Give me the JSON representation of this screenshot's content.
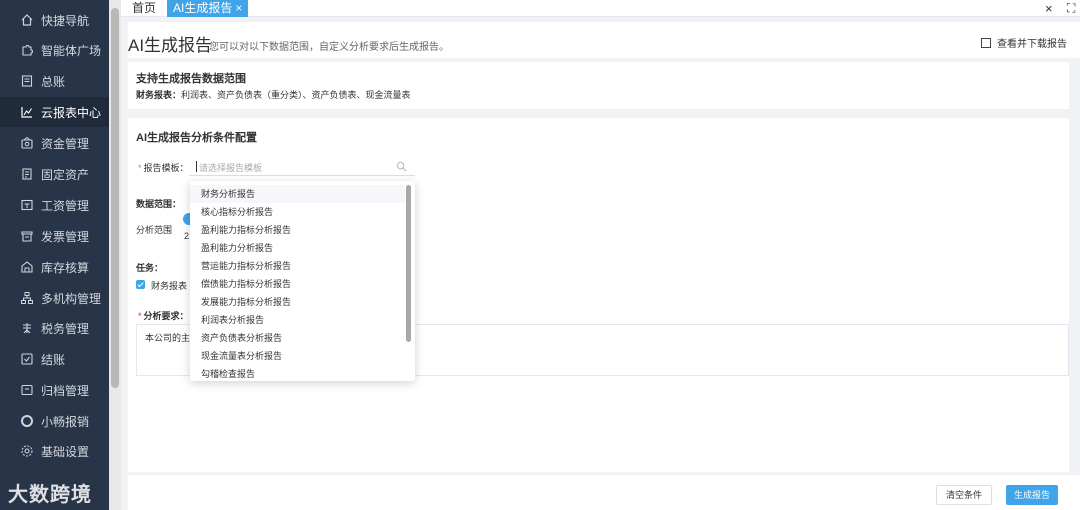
{
  "sidebar": {
    "items": [
      {
        "label": "快捷导航",
        "icon": "home-icon"
      },
      {
        "label": "智能体广场",
        "icon": "puzzle-icon"
      },
      {
        "label": "总账",
        "icon": "ledger-icon"
      },
      {
        "label": "云报表中心",
        "icon": "chart-icon",
        "active": true
      },
      {
        "label": "资金管理",
        "icon": "money-icon"
      },
      {
        "label": "固定资产",
        "icon": "asset-icon"
      },
      {
        "label": "工资管理",
        "icon": "salary-icon"
      },
      {
        "label": "发票管理",
        "icon": "invoice-icon"
      },
      {
        "label": "库存核算",
        "icon": "warehouse-icon"
      },
      {
        "label": "多机构管理",
        "icon": "org-icon"
      },
      {
        "label": "税务管理",
        "icon": "tax-icon"
      },
      {
        "label": "结账",
        "icon": "checkout-icon"
      },
      {
        "label": "归档管理",
        "icon": "archive-icon"
      },
      {
        "label": "小畅报销",
        "icon": "reimburse-icon"
      },
      {
        "label": "基础设置",
        "icon": "settings-icon"
      }
    ],
    "watermark": "大数跨境",
    "colors": {
      "bg": "#283447",
      "active": "#1f2a3a"
    }
  },
  "tabs": [
    {
      "label": "首页"
    },
    {
      "label": "AI生成报告",
      "active": true,
      "close": "×"
    }
  ],
  "window": {
    "close": "×",
    "fullscreen": "⛶"
  },
  "header": {
    "title": "AI生成报告",
    "subtitle": "您可以对以下数据范围，自定义分析要求后生成报告。",
    "download": "查看并下载报告"
  },
  "scope_card": {
    "title": "支持生成报告数据范围",
    "label": "财务报表：",
    "value": "利润表、资产负债表（重分类）、资产负债表、现金流量表"
  },
  "config_card": {
    "title": "AI生成报告分析条件配置",
    "template_label": "报告模板：",
    "template_placeholder": "请选择报告模板",
    "data_range_label": "数据范围：",
    "analysis_range_label": "分析范围",
    "analysis_range_value": "2",
    "task_label": "任务：",
    "task_checkbox_label": "财务报表",
    "requirement_label": "分析要求：",
    "requirement_text": "本公司的主"
  },
  "dropdown": {
    "options": [
      "财务分析报告",
      "核心指标分析报告",
      "盈利能力指标分析报告",
      "盈利能力分析报告",
      "营运能力指标分析报告",
      "偿债能力指标分析报告",
      "发展能力指标分析报告",
      "利润表分析报告",
      "资产负债表分析报告",
      "现金流量表分析报告",
      "勾稽检查报告"
    ],
    "hovered": 0
  },
  "footer": {
    "clear_label": "清空条件",
    "generate_label": "生成报告"
  },
  "colors": {
    "accent": "#3fa4e8"
  }
}
